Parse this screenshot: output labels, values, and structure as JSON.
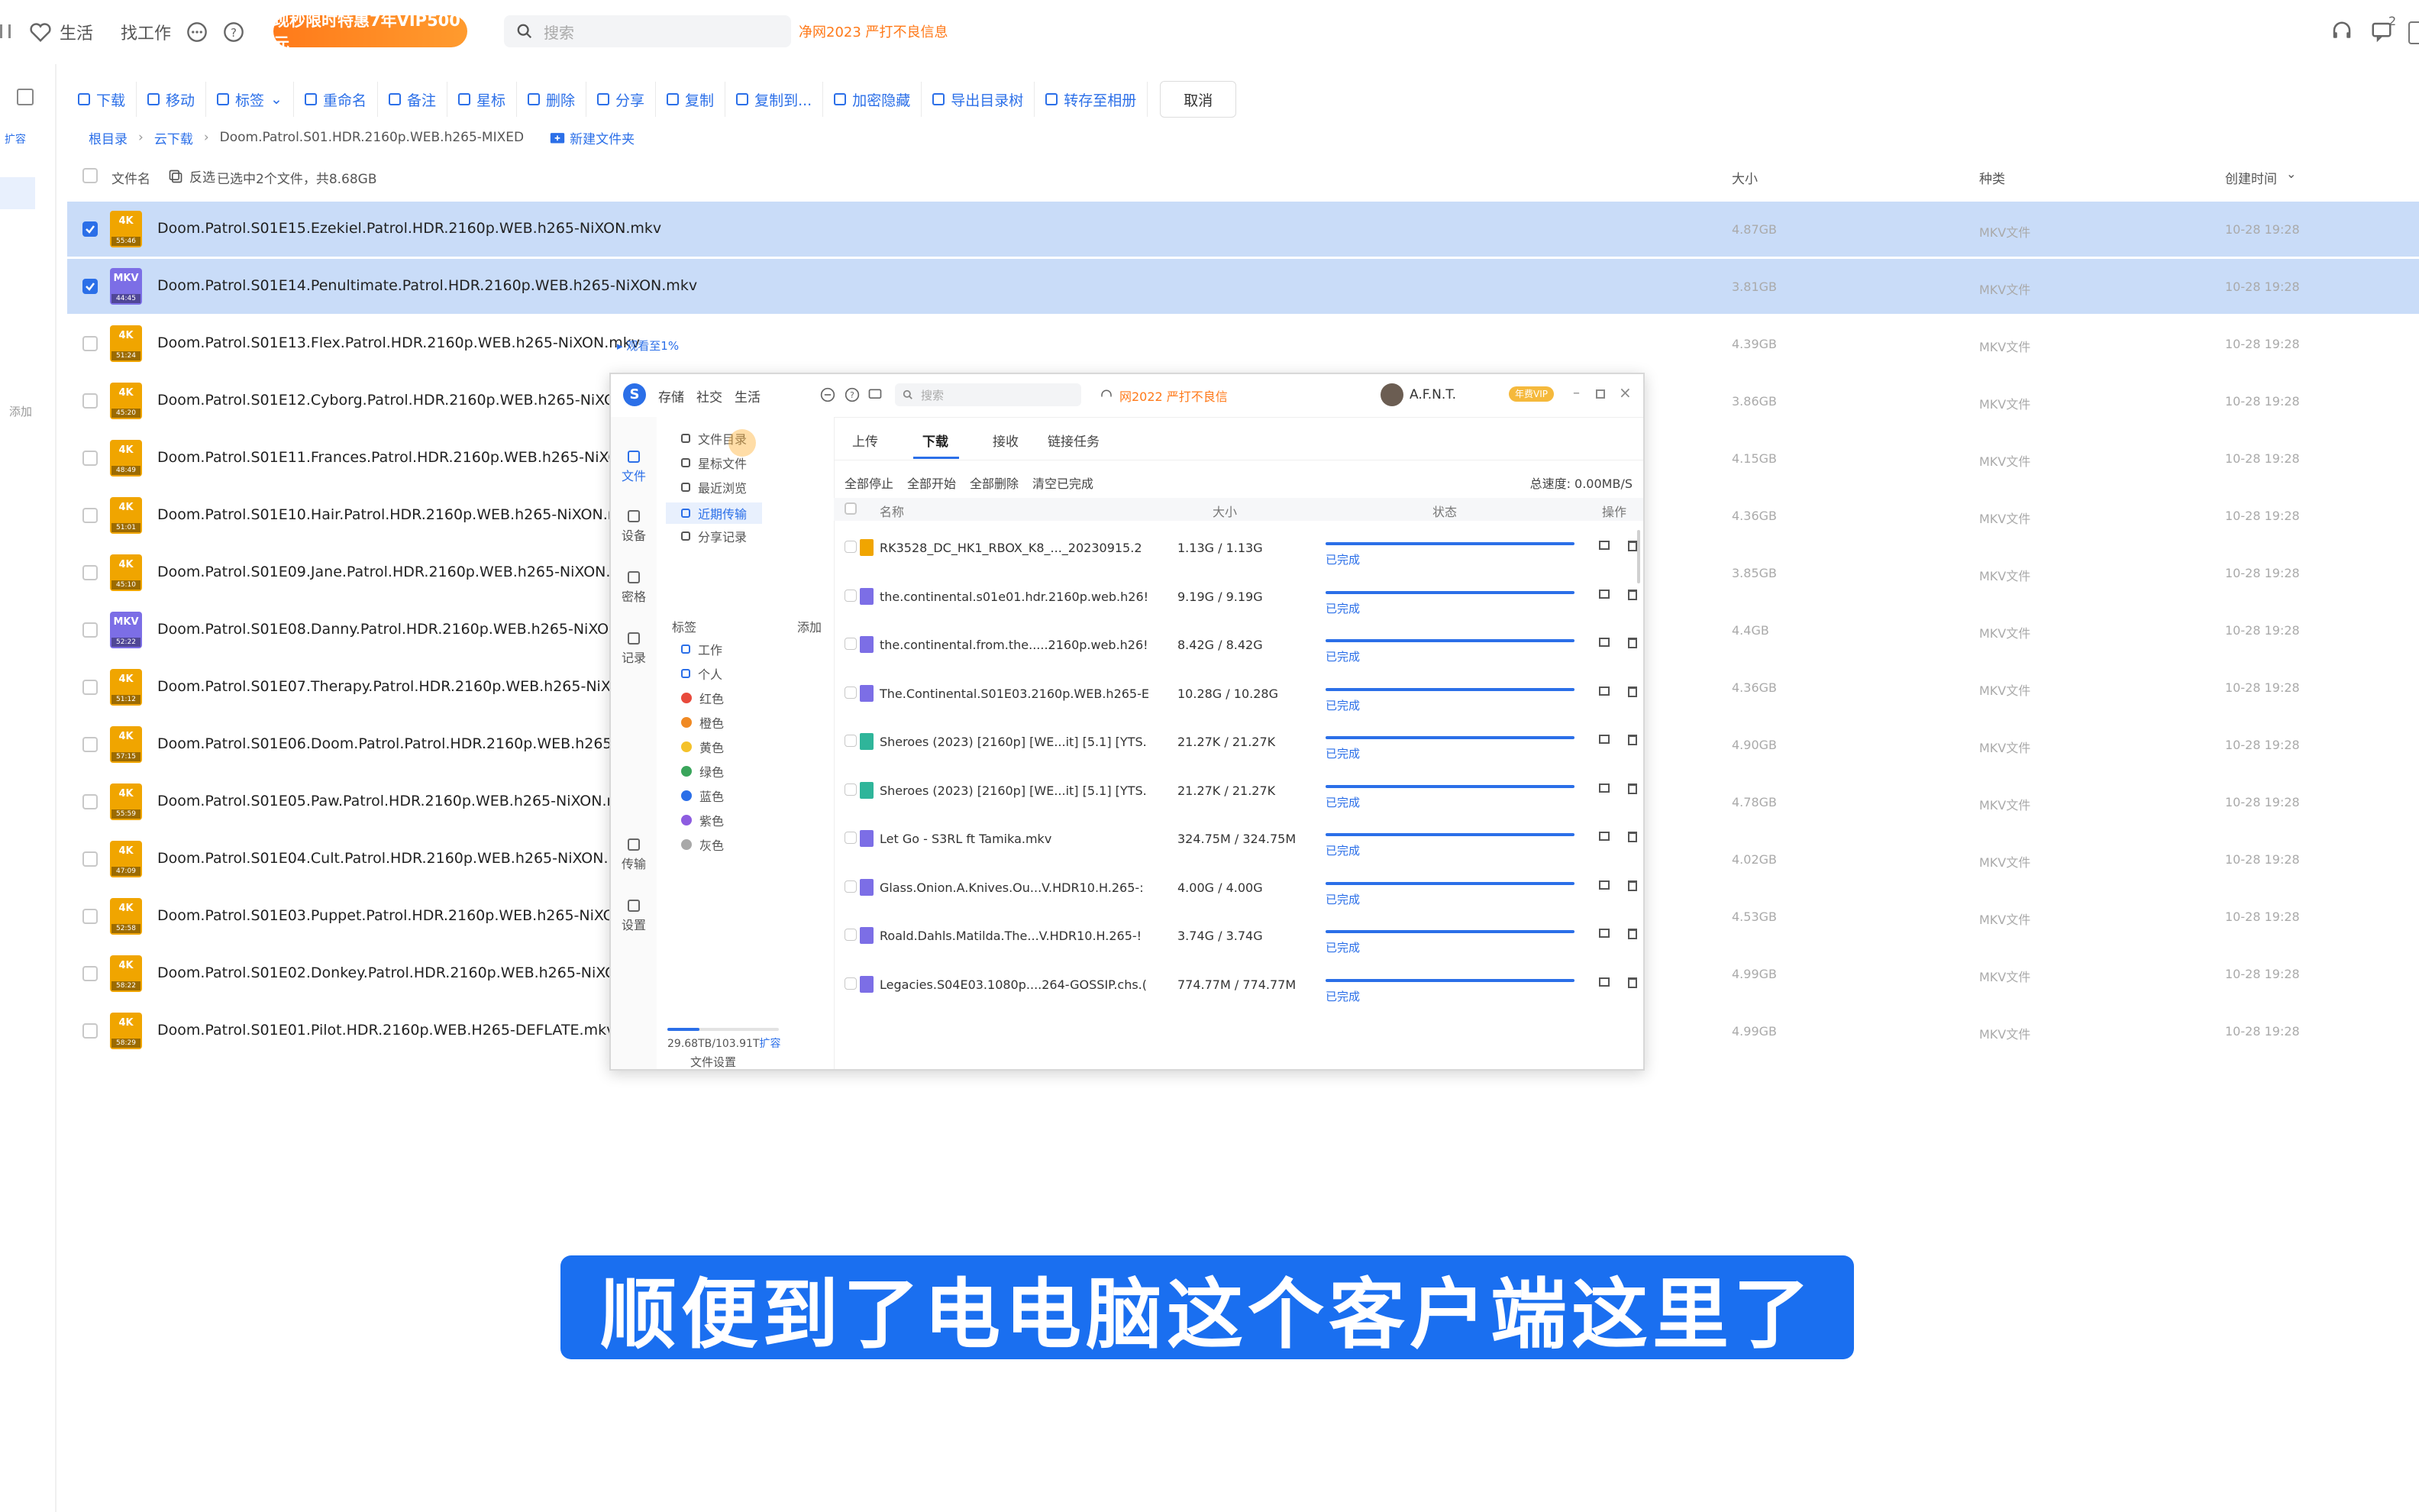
{
  "topbar": {
    "life": "生活",
    "jobs": "找工作",
    "promo": "现秒限时特惠7年VIP500元",
    "search_placeholder": "搜索",
    "warning": "净网2023 严打不良信息",
    "notification_count": "2"
  },
  "sidebar": {
    "badge": "扩容",
    "add": "添加"
  },
  "toolbar": [
    "下载",
    "移动",
    "标签",
    "重命名",
    "备注",
    "星标",
    "删除",
    "分享",
    "复制",
    "复制到...",
    "加密隐藏",
    "导出目录树",
    "转存至相册"
  ],
  "toolbar_cancel": "取消",
  "breadcrumb": {
    "root": "根目录",
    "cloud": "云下载",
    "current": "Doom.Patrol.S01.HDR.2160p.WEB.h265-MIXED",
    "new_folder": "新建文件夹"
  },
  "list_header": {
    "name": "文件名",
    "invert": "反选",
    "selected": "已选中2个文件，共8.68GB",
    "size": "大小",
    "type": "种类",
    "created": "创建时间"
  },
  "files": [
    {
      "name": "Doom.Patrol.S01E15.Ezekiel.Patrol.HDR.2160p.WEB.h265-NiXON.mkv",
      "size": "4.87GB",
      "type": "MKV文件",
      "date": "10-28 19:28",
      "selected": true,
      "thumb": "4K",
      "dur": "55:46",
      "color": "#f0a500"
    },
    {
      "name": "Doom.Patrol.S01E14.Penultimate.Patrol.HDR.2160p.WEB.h265-NiXON.mkv",
      "size": "3.81GB",
      "type": "MKV文件",
      "date": "10-28 19:28",
      "selected": true,
      "thumb": "MKV",
      "dur": "44:45",
      "color": "#7c6ee6"
    },
    {
      "name": "Doom.Patrol.S01E13.Flex.Patrol.HDR.2160p.WEB.h265-NiXON.mkv",
      "size": "4.39GB",
      "type": "MKV文件",
      "date": "10-28 19:28",
      "selected": false,
      "thumb": "4K",
      "dur": "51:24",
      "color": "#f0a500",
      "note": "▸ 观看至1%"
    },
    {
      "name": "Doom.Patrol.S01E12.Cyborg.Patrol.HDR.2160p.WEB.h265-NiXON.mkv",
      "size": "3.86GB",
      "type": "MKV文件",
      "date": "10-28 19:28",
      "selected": false,
      "thumb": "4K",
      "dur": "45:20",
      "color": "#f0a500"
    },
    {
      "name": "Doom.Patrol.S01E11.Frances.Patrol.HDR.2160p.WEB.h265-NiXON.mkv",
      "size": "4.15GB",
      "type": "MKV文件",
      "date": "10-28 19:28",
      "selected": false,
      "thumb": "4K",
      "dur": "48:49",
      "color": "#f0a500"
    },
    {
      "name": "Doom.Patrol.S01E10.Hair.Patrol.HDR.2160p.WEB.h265-NiXON.mkv",
      "size": "4.36GB",
      "type": "MKV文件",
      "date": "10-28 19:28",
      "selected": false,
      "thumb": "4K",
      "dur": "51:01",
      "color": "#f0a500"
    },
    {
      "name": "Doom.Patrol.S01E09.Jane.Patrol.HDR.2160p.WEB.h265-NiXON.mkv",
      "size": "3.85GB",
      "type": "MKV文件",
      "date": "10-28 19:28",
      "selected": false,
      "thumb": "4K",
      "dur": "45:10",
      "color": "#f0a500"
    },
    {
      "name": "Doom.Patrol.S01E08.Danny.Patrol.HDR.2160p.WEB.h265-NiXON.mkv",
      "size": "4.4GB",
      "type": "MKV文件",
      "date": "10-28 19:28",
      "selected": false,
      "thumb": "MKV",
      "dur": "52:22",
      "color": "#7c6ee6"
    },
    {
      "name": "Doom.Patrol.S01E07.Therapy.Patrol.HDR.2160p.WEB.h265-NiXON.mkv",
      "size": "4.36GB",
      "type": "MKV文件",
      "date": "10-28 19:28",
      "selected": false,
      "thumb": "4K",
      "dur": "51:12",
      "color": "#f0a500"
    },
    {
      "name": "Doom.Patrol.S01E06.Doom.Patrol.Patrol.HDR.2160p.WEB.h265-NiXON.mkv",
      "size": "4.90GB",
      "type": "MKV文件",
      "date": "10-28 19:28",
      "selected": false,
      "thumb": "4K",
      "dur": "57:15",
      "color": "#f0a500"
    },
    {
      "name": "Doom.Patrol.S01E05.Paw.Patrol.HDR.2160p.WEB.h265-NiXON.mkv",
      "size": "4.78GB",
      "type": "MKV文件",
      "date": "10-28 19:28",
      "selected": false,
      "thumb": "4K",
      "dur": "55:59",
      "color": "#f0a500"
    },
    {
      "name": "Doom.Patrol.S01E04.Cult.Patrol.HDR.2160p.WEB.h265-NiXON.mkv",
      "size": "4.02GB",
      "type": "MKV文件",
      "date": "10-28 19:28",
      "selected": false,
      "thumb": "4K",
      "dur": "47:09",
      "color": "#f0a500"
    },
    {
      "name": "Doom.Patrol.S01E03.Puppet.Patrol.HDR.2160p.WEB.h265-NiXON.mkv",
      "size": "4.53GB",
      "type": "MKV文件",
      "date": "10-28 19:28",
      "selected": false,
      "thumb": "4K",
      "dur": "52:58",
      "color": "#f0a500"
    },
    {
      "name": "Doom.Patrol.S01E02.Donkey.Patrol.HDR.2160p.WEB.h265-NiXON.mkv",
      "size": "4.99GB",
      "type": "MKV文件",
      "date": "10-28 19:28",
      "selected": false,
      "thumb": "4K",
      "dur": "58:22",
      "color": "#f0a500"
    },
    {
      "name": "Doom.Patrol.S01E01.Pilot.HDR.2160p.WEB.H265-DEFLATE.mkv",
      "size": "4.99GB",
      "type": "MKV文件",
      "date": "10-28 19:28",
      "selected": false,
      "thumb": "4K",
      "dur": "58:29",
      "color": "#f0a500"
    }
  ],
  "popup": {
    "nav": [
      "存储",
      "社交",
      "生活"
    ],
    "search_placeholder": "搜索",
    "warning": "网2022 严打不良信",
    "user": "A.F.N.T.",
    "vip": "年费VIP",
    "rail": [
      "文件",
      "设备",
      "密格",
      "记录",
      "传输",
      "设置"
    ],
    "side_items": [
      "文件目录",
      "星标文件",
      "最近浏览",
      "近期传输",
      "分享记录"
    ],
    "tags_title": "标签",
    "tags_add": "添加",
    "tags": [
      {
        "label": "工作",
        "color": ""
      },
      {
        "label": "个人",
        "color": ""
      },
      {
        "label": "红色",
        "color": "#e84a3c"
      },
      {
        "label": "橙色",
        "color": "#f08a24"
      },
      {
        "label": "黄色",
        "color": "#f4c22b"
      },
      {
        "label": "绿色",
        "color": "#3aa55b"
      },
      {
        "label": "蓝色",
        "color": "#2b6fe8"
      },
      {
        "label": "紫色",
        "color": "#8d5ce0"
      },
      {
        "label": "灰色",
        "color": "#a8a8a8"
      }
    ],
    "storage": "29.68TB/103.91T",
    "storage_link": "扩容",
    "storage_used": 0.29,
    "file_settings": "文件设置",
    "tabs": [
      "上传",
      "下载",
      "接收",
      "链接任务"
    ],
    "actions": [
      "全部停止",
      "全部开始",
      "全部删除",
      "清空已完成"
    ],
    "speed": "总速度: 0.00MB/S",
    "cols": [
      "名称",
      "大小",
      "状态",
      "操作"
    ],
    "transfers": [
      {
        "name": "RK3528_DC_HK1_RBOX_K8_..._20230915.2",
        "size": "1.13G / 1.13G",
        "status": "已完成",
        "icon": "#f0a500"
      },
      {
        "name": "the.continental.s01e01.hdr.2160p.web.h26!",
        "size": "9.19G / 9.19G",
        "status": "已完成",
        "icon": "#7c6ee6"
      },
      {
        "name": "the.continental.from.the.....2160p.web.h26!",
        "size": "8.42G / 8.42G",
        "status": "已完成",
        "icon": "#7c6ee6"
      },
      {
        "name": "The.Continental.S01E03.2160p.WEB.h265-E",
        "size": "10.28G / 10.28G",
        "status": "已完成",
        "icon": "#7c6ee6"
      },
      {
        "name": "Sheroes (2023) [2160p] [WE...it] [5.1] [YTS.",
        "size": "21.27K / 21.27K",
        "status": "已完成",
        "icon": "#2fb59a"
      },
      {
        "name": "Sheroes (2023) [2160p] [WE...it] [5.1] [YTS.",
        "size": "21.27K / 21.27K",
        "status": "已完成",
        "icon": "#2fb59a"
      },
      {
        "name": "Let Go - S3RL ft Tamika.mkv",
        "size": "324.75M / 324.75M",
        "status": "已完成",
        "icon": "#7c6ee6"
      },
      {
        "name": "Glass.Onion.A.Knives.Ou...V.HDR10.H.265-:",
        "size": "4.00G / 4.00G",
        "status": "已完成",
        "icon": "#7c6ee6"
      },
      {
        "name": "Roald.Dahls.Matilda.The...V.HDR10.H.265-!",
        "size": "3.74G / 3.74G",
        "status": "已完成",
        "icon": "#7c6ee6"
      },
      {
        "name": "Legacies.S04E03.1080p....264-GOSSIP.chs.(",
        "size": "774.77M / 774.77M",
        "status": "已完成",
        "icon": "#7c6ee6"
      }
    ]
  },
  "subtitle": "顺便到了电电脑这个客户端这里了",
  "colors": {
    "accent": "#2b6fe8",
    "selected_row": "#c9dcf8",
    "promo": "#ff7a1a",
    "banner": "#1a6ff0"
  }
}
